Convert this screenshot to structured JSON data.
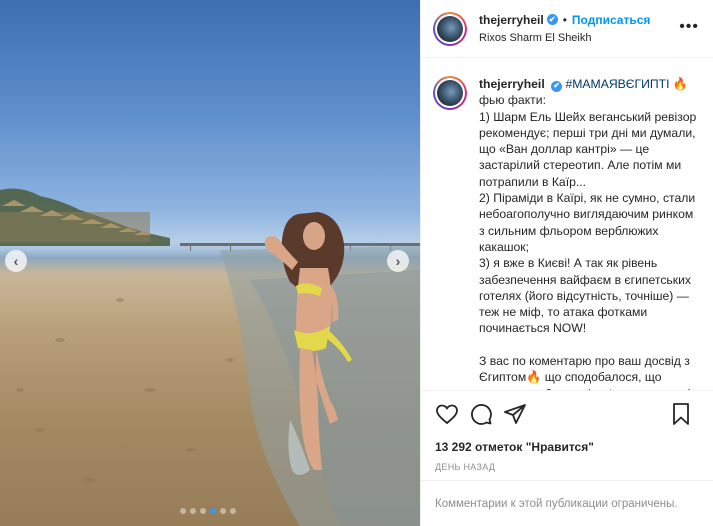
{
  "post": {
    "username": "thejerryheil",
    "verified_mark": "✔",
    "separator": "•",
    "follow_label": "Подписаться",
    "location": "Rixos Sharm El Sheikh",
    "more_icon": "more-horizontal-icon"
  },
  "caption": {
    "username": "thejerryheil",
    "hashtag": "#МАМАЯВЄГИПТІ",
    "emoji": "🔥",
    "text": "фью факти:\n1) Шарм Ель Шейх веганський ревізор рекомендує; перші три дні ми думали, що «Ван доллар кантрі» — це застарілий стереотип. Але потім ми потрапили в Каїр...\n2) Піраміди в Каїрі, як не сумно, стали небоагополучно виглядаючим ринком з сильним фльором верблюжих какашок;\n3) я вже в Києві! А так як рівень забезпечення вайфаєм в єгипетських готелях (його відсутність, точніше) — теж не міф, то атака фотками починається NOW!\n\nЗ вас по коментарю про ваш досвід з Єгиптом🔥 що сподобалося, що важливо побачити (окрім очевидного)"
  },
  "carousel": {
    "prev_icon": "chevron-left-icon",
    "next_icon": "chevron-right-icon",
    "prev_glyph": "‹",
    "next_glyph": "›",
    "total_slides": 6,
    "active_slide": 4
  },
  "actions": {
    "like_icon": "heart-icon",
    "comment_icon": "comment-icon",
    "share_icon": "share-icon",
    "save_icon": "bookmark-icon"
  },
  "stats": {
    "likes_text": "13 292 отметок \"Нравится\"",
    "time_ago": "ДЕНЬ НАЗАД"
  },
  "comments": {
    "disabled_text": "Комментарии к этой публикации ограничены."
  },
  "colors": {
    "accent": "#0095f6",
    "carousel_active_dot": "#3897f0",
    "hashtag": "#00376b",
    "muted": "#8e8e8e"
  }
}
